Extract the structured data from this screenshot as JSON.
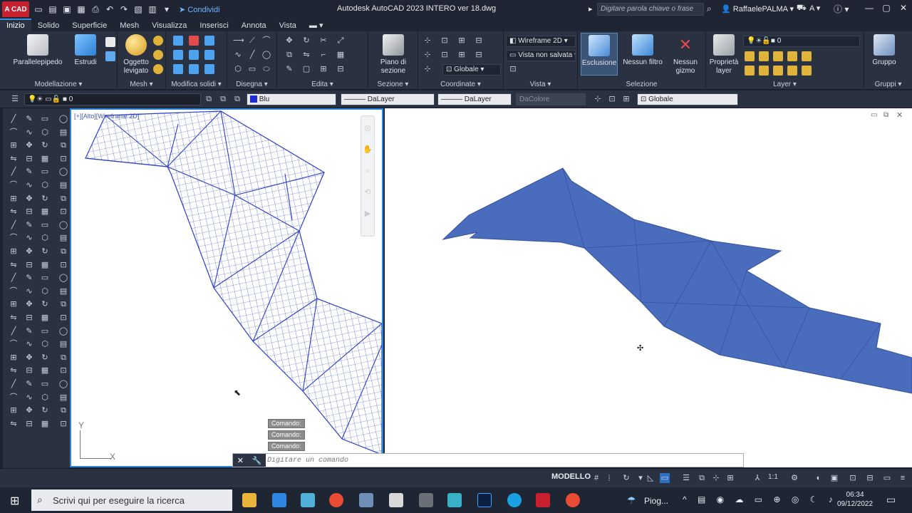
{
  "titlebar": {
    "app_badge": "A CAD",
    "share": "Condividi",
    "title": "Autodesk AutoCAD 2023    INTERO ver 18.dwg",
    "search_placeholder": "Digitare parola chiave o frase",
    "user": "RaffaelePALMA"
  },
  "tabs": [
    "Inizio",
    "Solido",
    "Superficie",
    "Mesh",
    "Visualizza",
    "Inserisci",
    "Annota",
    "Vista"
  ],
  "ribbon": {
    "parallelepipedo": "Parallelepipedo",
    "estrudi": "Estrudi",
    "oggetto_levigato": "Oggetto\nlevigato",
    "piano_di_sezione": "Piano di\nsezione",
    "wireframe": "Wireframe 2D",
    "vista_non_salvata": "Vista non salvata",
    "globale": "Globale",
    "esclusione": "Esclusione",
    "nessun_filtro": "Nessun filtro",
    "nessun_gizmo": "Nessun\ngizmo",
    "proprieta_layer": "Proprietà\nlayer",
    "gruppo": "Gruppo",
    "layer_value": "0",
    "panels": {
      "modellazione": "Modellazione",
      "mesh": "Mesh",
      "modifica_solidi": "Modifica solidi",
      "disegna": "Disegna",
      "edita": "Edita",
      "sezione": "Sezione",
      "coordinate": "Coordinate",
      "vista": "Vista",
      "selezione": "Selezione",
      "layer": "Layer",
      "gruppi": "Gruppi"
    }
  },
  "propbar": {
    "layer": "0",
    "color": "Blu",
    "linetype": "DaLayer",
    "lineweight": "DaLayer",
    "plotstyle": "DaColore",
    "ucs": "Globale"
  },
  "viewport_left": {
    "label": "[+][Alto][Wireframe 2D]",
    "command_history": [
      "Comando:",
      "Comando:",
      "Comando:"
    ],
    "axis_y": "Y",
    "axis_x": "X"
  },
  "command_line": {
    "placeholder": "Digitare un comando"
  },
  "statusbar": {
    "model": "MODELLO",
    "scale": "1:1"
  },
  "taskbar": {
    "search": "Scrivi qui per eseguire la ricerca",
    "weather": "Piog...",
    "time": "06:34",
    "date": "09/12/2022"
  },
  "colors": {
    "accent": "#2f86e0",
    "mesh_blue": "#2b3fc4",
    "surface_blue": "#4a6cbc"
  }
}
